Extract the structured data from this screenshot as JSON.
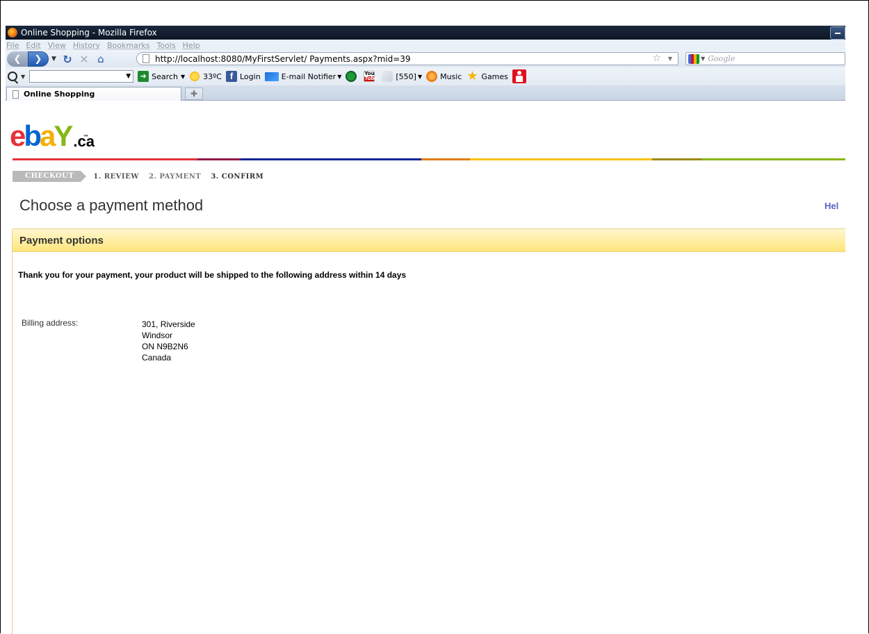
{
  "window": {
    "title": "Online Shopping - Mozilla Firefox"
  },
  "menu": [
    "File",
    "Edit",
    "View",
    "History",
    "Bookmarks",
    "Tools",
    "Help"
  ],
  "nav": {
    "url": "http://localhost:8080/MyFirstServlet/ Payments.aspx?mid=39",
    "search_placeholder": "Google"
  },
  "toolbar": {
    "search_label": "Search",
    "weather": "33ºC",
    "login": "Login",
    "email": "E-mail Notifier",
    "count": "[550]",
    "music": "Music",
    "games": "Games"
  },
  "tabs": [
    {
      "label": "Online Shopping"
    }
  ],
  "page": {
    "logo_suffix": ".ca",
    "logo_tm": "™",
    "checkout_label": "CHECKOUT",
    "steps": [
      "1. REVIEW",
      "2. PAYMENT",
      "3. CONFIRM"
    ],
    "title": "Choose a payment method",
    "help_link": "Hel",
    "panel_title": "Payment options",
    "thanks_message": "Thank you for your payment, your product will be shipped to the following address within 14 days",
    "billing_label": "Billing address:",
    "address": [
      "301, Riverside",
      "Windsor",
      "ON N9B2N6",
      "Canada"
    ]
  },
  "colors": {
    "rainbow": [
      "#e53238",
      "#8f1a47",
      "#0a2596",
      "#e07a10",
      "#f5c10b",
      "#9a8a1a",
      "#86b817"
    ]
  }
}
